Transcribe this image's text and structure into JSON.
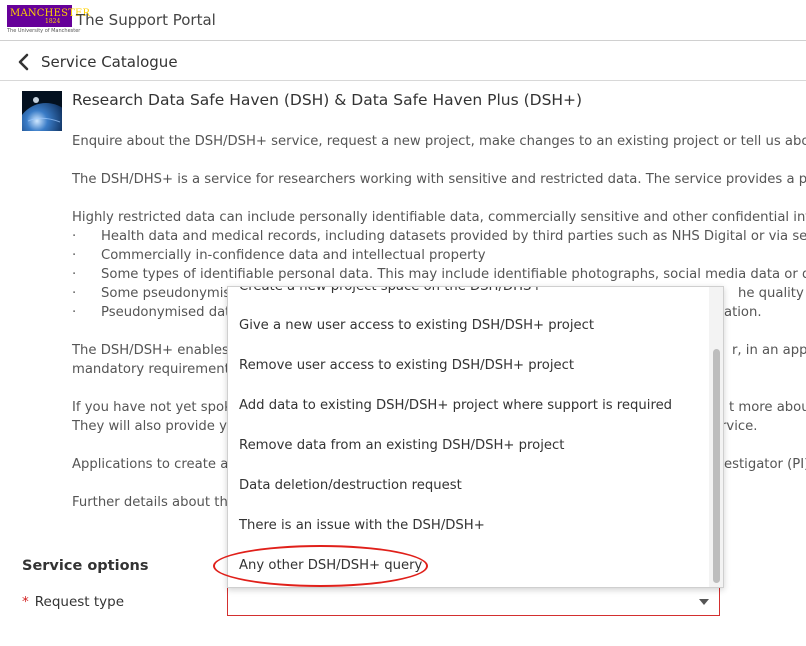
{
  "header": {
    "logo_word": "MANCHESTER",
    "logo_year": "1824",
    "logo_sub": "The University of Manchester",
    "portal_title": "The Support Portal"
  },
  "subbar": {
    "title": "Service Catalogue"
  },
  "item": {
    "title": "Research Data Safe Haven (DSH) & Data Safe Haven Plus (DSH+)",
    "paragraphs": [
      "Enquire about the DSH/DSH+ service, request a new project, make changes to an existing project or tell us about",
      "The DSH/DHS+ is a service for researchers working with sensitive and restricted data. The service provides a platf",
      "Highly restricted data can include personally identifiable data, commercially sensitive and other confidential infor"
    ],
    "bullet_char": "·",
    "bullets": [
      "Health data and medical records, including datasets provided by third parties such as NHS Digital or via secti",
      "Commercially in-confidence data and intellectual property",
      "Some types of identifiable personal data. This may include identifiable photographs, social media data or qua",
      "Some pseudonymis",
      "Pseudonymised dat"
    ],
    "bullet_tails": [
      "he quality of",
      "ation."
    ],
    "para4_line1": "The DSH/DSH+ enables",
    "para4_line1_tail": "r, in an appro",
    "para4_line2": "mandatory requirement",
    "para5_line1": "If you have not yet spok",
    "para5_line1_tail": "t more about",
    "para5_line2": "They will also provide yo",
    "para5_line2_tail": "rvice.",
    "para6": "Applications to create a",
    "para6_tail": "estigator (PI) o",
    "para7": "Further details about th"
  },
  "service_options": {
    "title": "Service options",
    "request_type_label": "Request type",
    "required_marker": "*",
    "selected_value": "",
    "options": [
      "Create a new project space on the DSH/DHS+",
      "Give a new user access to existing DSH/DSH+ project",
      "Remove user access to existing DSH/DSH+ project",
      "Add data to existing DSH/DSH+ project where support is required",
      "Remove data from an existing DSH/DSH+ project",
      "Data deletion/destruction request",
      "There is an issue with the DSH/DSH+",
      "Any other DSH/DSH+ query"
    ]
  },
  "colors": {
    "brand_purple": "#660099",
    "brand_gold": "#ffd200",
    "required_red": "#d21f1f",
    "annotation_red": "#e0201a"
  },
  "icons": [
    "back-chevron-icon",
    "dropdown-chevron-icon"
  ]
}
